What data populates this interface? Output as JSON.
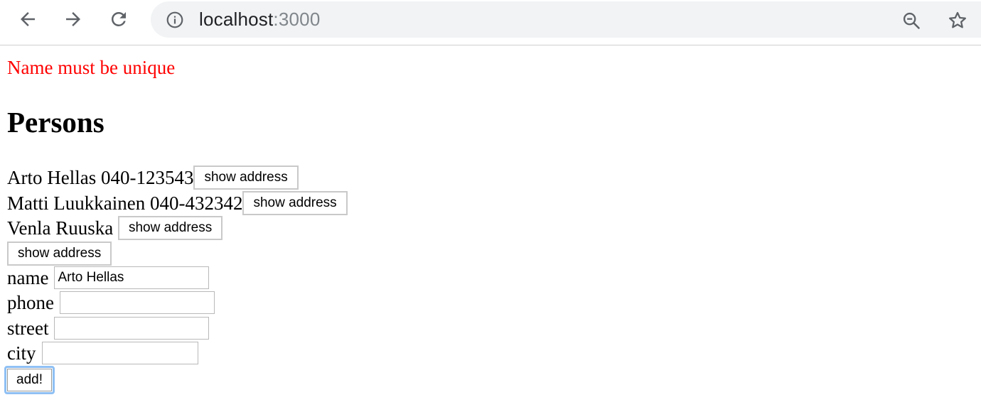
{
  "browser": {
    "url_host": "localhost",
    "url_port": ":3000",
    "icons": [
      "back-arrow-icon",
      "forward-arrow-icon",
      "reload-icon",
      "info-icon",
      "zoom-out-icon",
      "bookmark-star-icon"
    ]
  },
  "notification": {
    "text": "Name must be unique",
    "color": "#ff0000"
  },
  "page": {
    "heading": "Persons",
    "persons": [
      {
        "text": "Arto Hellas 040-123543",
        "button": "show address"
      },
      {
        "text": "Matti Luukkainen 040-432342",
        "button": "show address"
      },
      {
        "text": "Venla Ruuska",
        "button": "show address"
      },
      {
        "text": "",
        "button": "show address"
      }
    ]
  },
  "form": {
    "name_label": "name",
    "name_value": "Arto Hellas",
    "phone_label": "phone",
    "phone_value": "",
    "street_label": "street",
    "street_value": "",
    "city_label": "city",
    "city_value": "",
    "submit_label": "add!"
  },
  "colors": {
    "focus_ring": "#8fc0f4",
    "omnibox_bg": "#f1f3f4"
  }
}
